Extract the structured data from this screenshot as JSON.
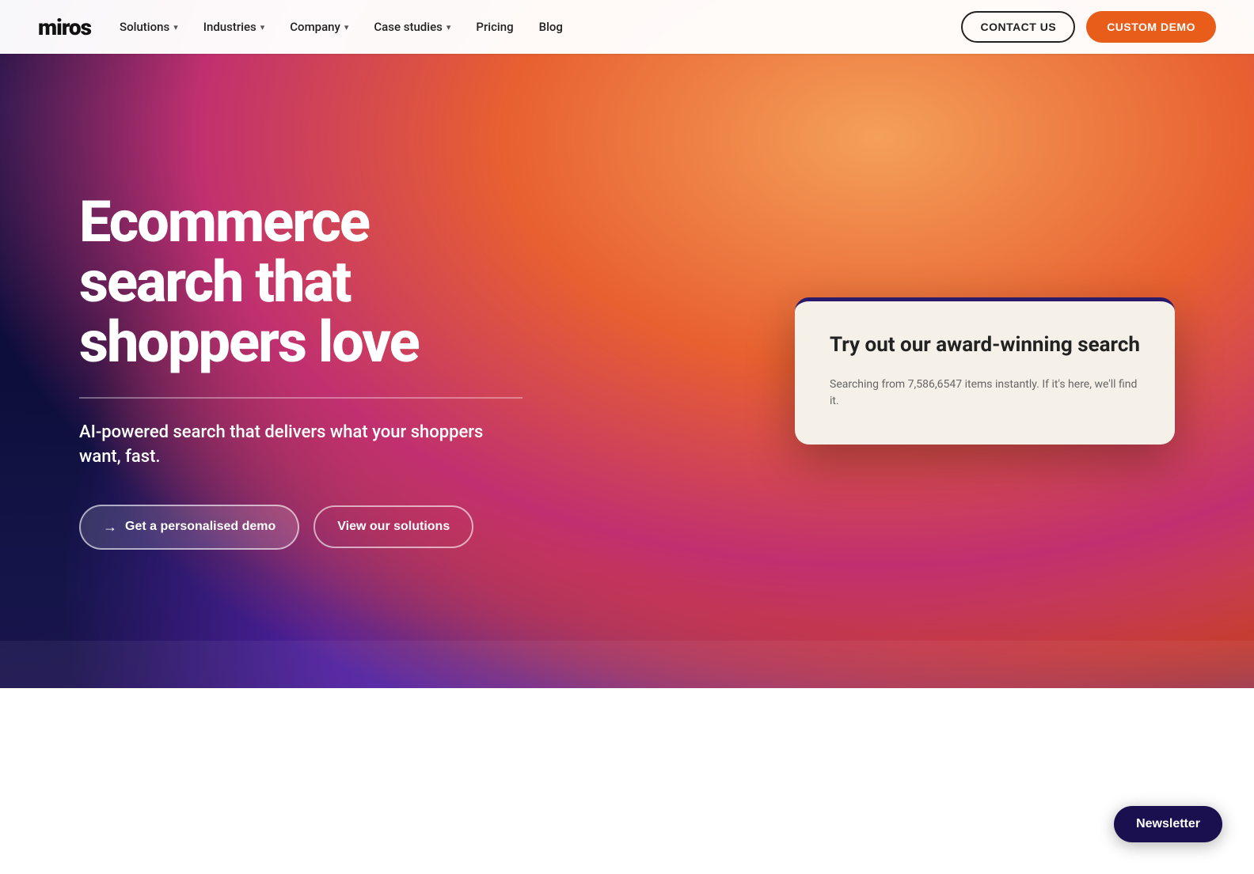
{
  "brand": {
    "logo": "miros"
  },
  "nav": {
    "links": [
      {
        "label": "Solutions",
        "hasDropdown": true
      },
      {
        "label": "Industries",
        "hasDropdown": true
      },
      {
        "label": "Company",
        "hasDropdown": true
      },
      {
        "label": "Case studies",
        "hasDropdown": true
      },
      {
        "label": "Pricing",
        "hasDropdown": false
      },
      {
        "label": "Blog",
        "hasDropdown": false
      }
    ],
    "contact_label": "CONTACT US",
    "demo_label": "CUSTOM DEMO"
  },
  "hero": {
    "heading": "Ecommerce search that shoppers love",
    "subtext": "AI-powered search that delivers what your shoppers want, fast.",
    "btn_demo_label": "Get a personalised demo",
    "btn_solutions_label": "View our solutions"
  },
  "search_card": {
    "title": "Try out our award-winning search",
    "subtitle": "Searching from 7,586,6547 items instantly. If it's here, we'll find it."
  },
  "newsletter": {
    "label": "Newsletter"
  }
}
